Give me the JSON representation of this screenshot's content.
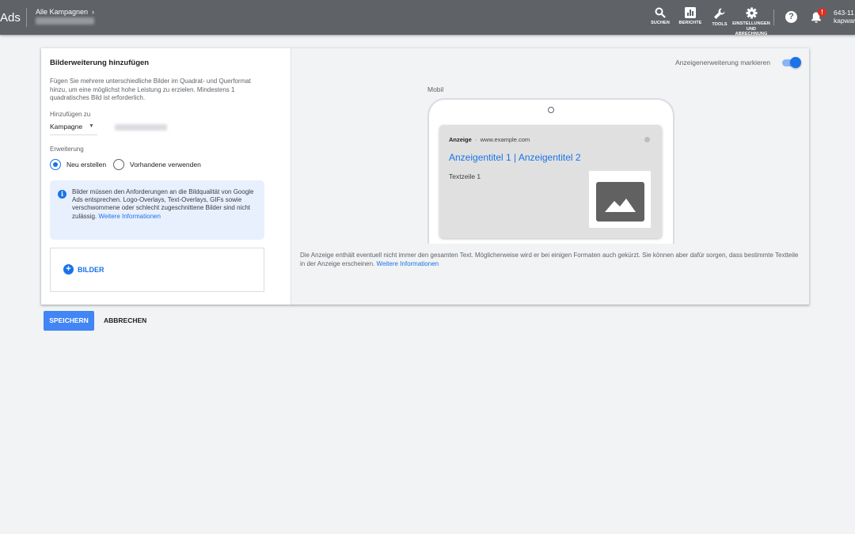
{
  "header": {
    "logo_text": "Ads",
    "breadcrumb": "Alle Kampagnen",
    "breadcrumb_chevron": "›",
    "tools": [
      {
        "icon": "search-icon",
        "label": "SUCHEN"
      },
      {
        "icon": "reports-icon",
        "label": "BERICHTE"
      },
      {
        "icon": "wrench-icon",
        "label": "TOOLS"
      },
      {
        "icon": "gear-icon",
        "label": "EINSTELLUNGEN UND ABRECHNUNG"
      }
    ],
    "help_glyph": "?",
    "notification_badge": "!",
    "account_id": "643-11",
    "account_name": "kapwar"
  },
  "panel": {
    "title": "Bilderweiterung hinzufügen",
    "description": "Fügen Sie mehrere unterschiedliche Bilder im Quadrat- und Querformat hinzu, um eine möglichst hohe Leistung zu erzielen. Mindestens 1 quadratisches Bild ist erforderlich.",
    "add_to_label": "Hinzufügen zu",
    "add_to_value": "Kampagne",
    "extension_label": "Erweiterung",
    "radio_new": "Neu erstellen",
    "radio_existing": "Vorhandene verwenden",
    "info_text": "Bilder müssen den Anforderungen an die Bildqualität von Google Ads entsprechen. Logo-Overlays, Text-Overlays, GIFs sowie verschwommene oder schlecht zugeschnittene Bilder sind nicht zulässig.",
    "info_link": "Weitere Informationen",
    "add_images_label": "BILDER"
  },
  "preview": {
    "toggle_label": "Anzeigenerweiterung markieren",
    "toggle_on": true,
    "device_label": "Mobil",
    "ad_badge": "Anzeige",
    "ad_url": "www.example.com",
    "ad_headline": "Anzeigentitel 1 | Anzeigentitel 2",
    "ad_text": "Textzeile 1",
    "note": "Die Anzeige enthält eventuell nicht immer den gesamten Text. Möglicherweise wird er bei einigen Formaten auch gekürzt. Sie können aber dafür sorgen, dass bestimmte Textteile in der Anzeige erscheinen.",
    "note_link": "Weitere Informationen"
  },
  "actions": {
    "save": "SPEICHERN",
    "cancel": "ABBRECHEN"
  },
  "colors": {
    "header_bg": "#5f6368",
    "accent": "#1a73e8",
    "save_button": "#4285f4",
    "info_bg": "#e8f0fe",
    "page_bg": "#f1f3f4"
  }
}
